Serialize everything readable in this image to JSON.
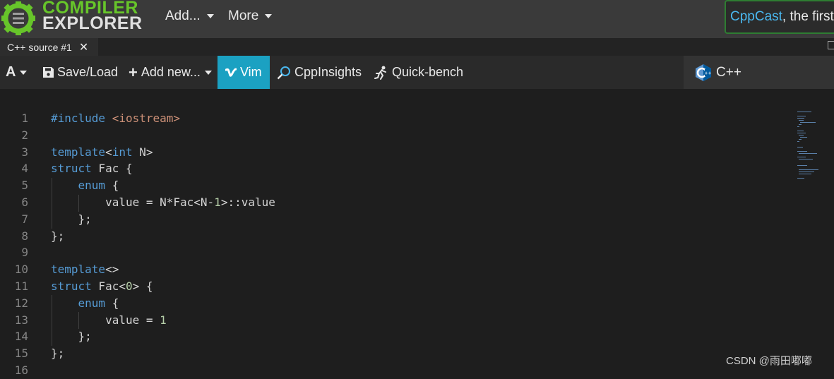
{
  "logo": {
    "line1": "COMPILER",
    "line2": "EXPLORER"
  },
  "nav": {
    "add_label": "Add...",
    "more_label": "More"
  },
  "news": {
    "link": "CppCast",
    "text": ", the first"
  },
  "tab": {
    "label": "C++ source #1",
    "close": "✕"
  },
  "toolbar": {
    "font_label": "A",
    "save_label": "Save/Load",
    "add_new_label": "Add new...",
    "vim_label": "Vim",
    "cppinsights_label": "CppInsights",
    "quickbench_label": "Quick-bench",
    "language_label": "C++"
  },
  "editor": {
    "line_numbers": [
      "1",
      "2",
      "3",
      "4",
      "5",
      "6",
      "7",
      "8",
      "9",
      "10",
      "11",
      "12",
      "13",
      "14",
      "15",
      "16"
    ],
    "lines": [
      [
        {
          "t": "#include ",
          "c": "kw"
        },
        {
          "t": "<iostream>",
          "c": "str"
        }
      ],
      [],
      [
        {
          "t": "template",
          "c": "kw"
        },
        {
          "t": "<"
        },
        {
          "t": "int",
          "c": "kw"
        },
        {
          "t": " N>"
        }
      ],
      [
        {
          "t": "struct",
          "c": "kw"
        },
        {
          "t": " Fac {"
        }
      ],
      [
        {
          "t": "    "
        },
        {
          "t": "enum",
          "c": "kw"
        },
        {
          "t": " {"
        }
      ],
      [
        {
          "t": "        value = N*Fac<N-"
        },
        {
          "t": "1",
          "c": "num"
        },
        {
          "t": ">::value"
        }
      ],
      [
        {
          "t": "    };"
        }
      ],
      [
        {
          "t": "};"
        }
      ],
      [],
      [
        {
          "t": "template",
          "c": "kw"
        },
        {
          "t": "<>"
        }
      ],
      [
        {
          "t": "struct",
          "c": "kw"
        },
        {
          "t": " Fac<"
        },
        {
          "t": "0",
          "c": "num"
        },
        {
          "t": "> {"
        }
      ],
      [
        {
          "t": "    "
        },
        {
          "t": "enum",
          "c": "kw"
        },
        {
          "t": " {"
        }
      ],
      [
        {
          "t": "        value = "
        },
        {
          "t": "1",
          "c": "num"
        }
      ],
      [
        {
          "t": "    };"
        }
      ],
      [
        {
          "t": "};"
        }
      ],
      []
    ]
  },
  "watermark": "CSDN @雨田嘟嘟",
  "colors": {
    "accent_green": "#67c52a",
    "vim_bg": "#1ba1c2",
    "keyword": "#569cd6",
    "string": "#ce9178",
    "number": "#b5cea8"
  }
}
